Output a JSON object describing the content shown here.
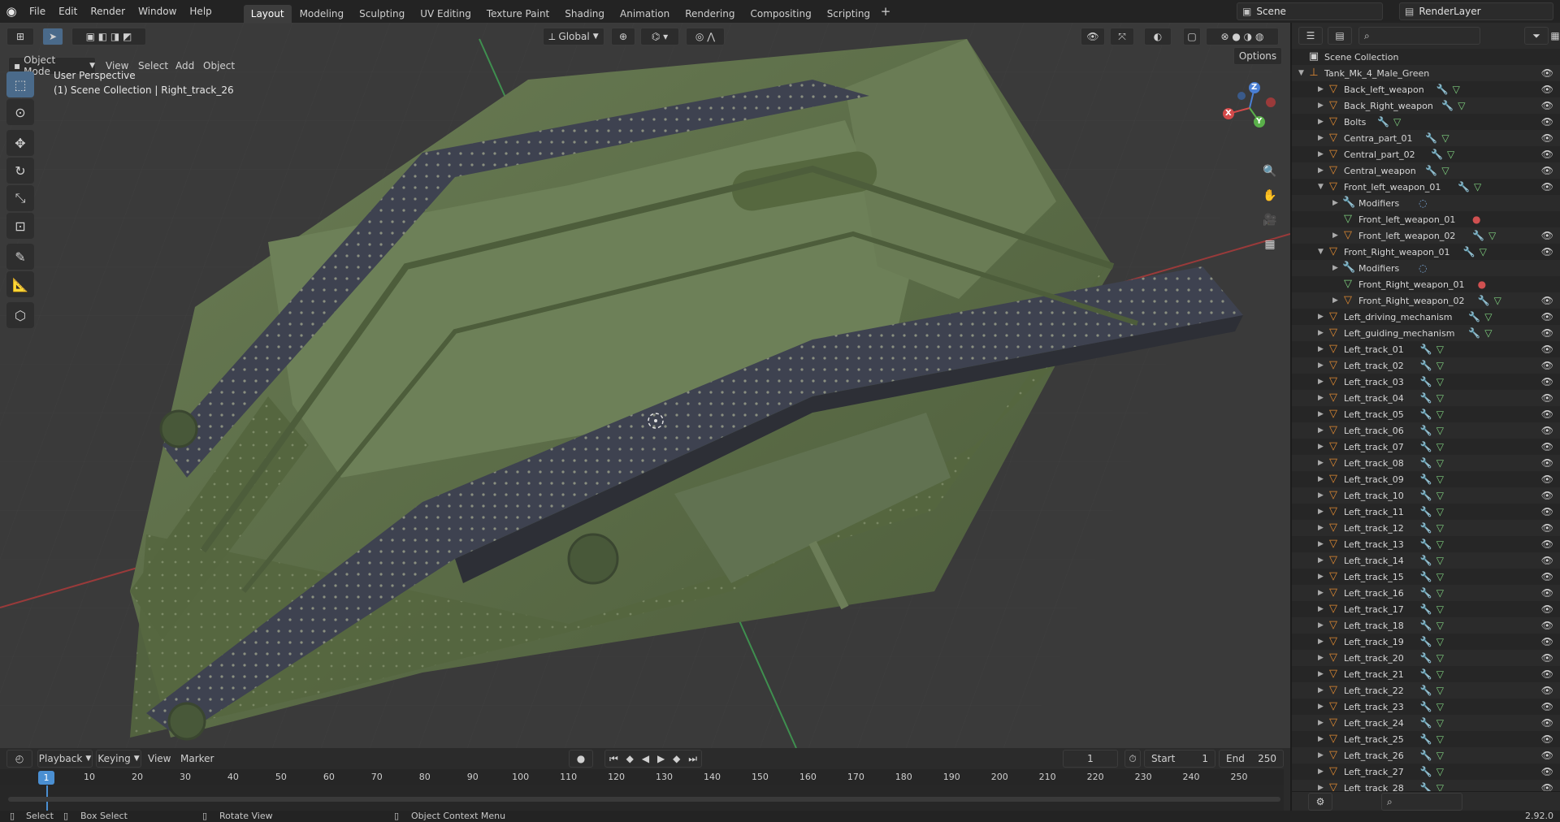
{
  "menu": [
    "File",
    "Edit",
    "Render",
    "Window",
    "Help"
  ],
  "workspaces": [
    {
      "label": "Layout",
      "active": true
    },
    {
      "label": "Modeling",
      "active": false
    },
    {
      "label": "Sculpting",
      "active": false
    },
    {
      "label": "UV Editing",
      "active": false
    },
    {
      "label": "Texture Paint",
      "active": false
    },
    {
      "label": "Shading",
      "active": false
    },
    {
      "label": "Animation",
      "active": false
    },
    {
      "label": "Rendering",
      "active": false
    },
    {
      "label": "Compositing",
      "active": false
    },
    {
      "label": "Scripting",
      "active": false
    }
  ],
  "scene": {
    "name": "Scene",
    "render_layer": "RenderLayer"
  },
  "viewport": {
    "mode": "Object Mode",
    "menus": [
      "View",
      "Select",
      "Add",
      "Object"
    ],
    "transform_orientation": "Global",
    "options_label": "Options",
    "perspective": "User Perspective",
    "context": "(1) Scene Collection | Right_track_26"
  },
  "timeline": {
    "menus": [
      "Playback",
      "Keying",
      "View",
      "Marker"
    ],
    "current_frame": "1",
    "start_label": "Start",
    "start": "1",
    "end_label": "End",
    "end": "250",
    "ticks": [
      "1",
      "10",
      "20",
      "30",
      "40",
      "50",
      "60",
      "70",
      "80",
      "90",
      "100",
      "110",
      "120",
      "130",
      "140",
      "150",
      "160",
      "170",
      "180",
      "190",
      "200",
      "210",
      "220",
      "230",
      "240",
      "250"
    ]
  },
  "statusbar": {
    "select": "Select",
    "box_select": "Box Select",
    "rotate_view": "Rotate View",
    "context_menu": "Object Context Menu",
    "version": "2.92.0"
  },
  "outliner": {
    "root": "Scene Collection",
    "items": [
      {
        "name": "Tank_Mk_4_Male_Green",
        "depth": 1,
        "expanded": true,
        "type": "empty"
      },
      {
        "name": "Back_left_weapon",
        "depth": 2,
        "type": "mesh"
      },
      {
        "name": "Back_Right_weapon",
        "depth": 2,
        "type": "mesh"
      },
      {
        "name": "Bolts",
        "depth": 2,
        "type": "mesh"
      },
      {
        "name": "Centra_part_01",
        "depth": 2,
        "type": "mesh"
      },
      {
        "name": "Central_part_02",
        "depth": 2,
        "type": "mesh"
      },
      {
        "name": "Central_weapon",
        "depth": 2,
        "type": "mesh"
      },
      {
        "name": "Front_left_weapon_01",
        "depth": 2,
        "expanded": true,
        "type": "mesh"
      },
      {
        "name": "Modifiers",
        "depth": 3,
        "type": "modifiers"
      },
      {
        "name": "Front_left_weapon_01",
        "depth": 3,
        "type": "meshdata"
      },
      {
        "name": "Front_left_weapon_02",
        "depth": 3,
        "type": "mesh"
      },
      {
        "name": "Front_Right_weapon_01",
        "depth": 2,
        "expanded": true,
        "type": "mesh"
      },
      {
        "name": "Modifiers",
        "depth": 3,
        "type": "modifiers"
      },
      {
        "name": "Front_Right_weapon_01",
        "depth": 3,
        "type": "meshdata"
      },
      {
        "name": "Front_Right_weapon_02",
        "depth": 3,
        "type": "mesh"
      },
      {
        "name": "Left_driving_mechanism",
        "depth": 2,
        "type": "mesh"
      },
      {
        "name": "Left_guiding_mechanism",
        "depth": 2,
        "type": "mesh"
      },
      {
        "name": "Left_track_01",
        "depth": 2,
        "type": "mesh"
      },
      {
        "name": "Left_track_02",
        "depth": 2,
        "type": "mesh"
      },
      {
        "name": "Left_track_03",
        "depth": 2,
        "type": "mesh"
      },
      {
        "name": "Left_track_04",
        "depth": 2,
        "type": "mesh"
      },
      {
        "name": "Left_track_05",
        "depth": 2,
        "type": "mesh"
      },
      {
        "name": "Left_track_06",
        "depth": 2,
        "type": "mesh"
      },
      {
        "name": "Left_track_07",
        "depth": 2,
        "type": "mesh"
      },
      {
        "name": "Left_track_08",
        "depth": 2,
        "type": "mesh"
      },
      {
        "name": "Left_track_09",
        "depth": 2,
        "type": "mesh"
      },
      {
        "name": "Left_track_10",
        "depth": 2,
        "type": "mesh"
      },
      {
        "name": "Left_track_11",
        "depth": 2,
        "type": "mesh"
      },
      {
        "name": "Left_track_12",
        "depth": 2,
        "type": "mesh"
      },
      {
        "name": "Left_track_13",
        "depth": 2,
        "type": "mesh"
      },
      {
        "name": "Left_track_14",
        "depth": 2,
        "type": "mesh"
      },
      {
        "name": "Left_track_15",
        "depth": 2,
        "type": "mesh"
      },
      {
        "name": "Left_track_16",
        "depth": 2,
        "type": "mesh"
      },
      {
        "name": "Left_track_17",
        "depth": 2,
        "type": "mesh"
      },
      {
        "name": "Left_track_18",
        "depth": 2,
        "type": "mesh"
      },
      {
        "name": "Left_track_19",
        "depth": 2,
        "type": "mesh"
      },
      {
        "name": "Left_track_20",
        "depth": 2,
        "type": "mesh"
      },
      {
        "name": "Left_track_21",
        "depth": 2,
        "type": "mesh"
      },
      {
        "name": "Left_track_22",
        "depth": 2,
        "type": "mesh"
      },
      {
        "name": "Left_track_23",
        "depth": 2,
        "type": "mesh"
      },
      {
        "name": "Left_track_24",
        "depth": 2,
        "type": "mesh"
      },
      {
        "name": "Left_track_25",
        "depth": 2,
        "type": "mesh"
      },
      {
        "name": "Left_track_26",
        "depth": 2,
        "type": "mesh"
      },
      {
        "name": "Left_track_27",
        "depth": 2,
        "type": "mesh"
      },
      {
        "name": "Left_track_28",
        "depth": 2,
        "type": "mesh"
      }
    ]
  },
  "gizmo": {
    "x": "X",
    "y": "Y",
    "z": "Z"
  },
  "colors": {
    "accent": "#4a8fd2",
    "object_orange": "#e08a32",
    "tank_green": "#5d6f4a",
    "track_dark": "#3e4250"
  }
}
